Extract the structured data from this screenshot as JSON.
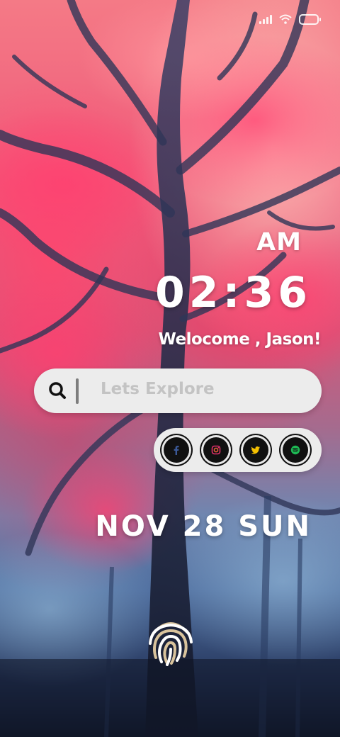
{
  "status_bar": {
    "signal_icon": "signal-bars-icon",
    "wifi_icon": "wifi-icon",
    "battery_icon": "battery-icon"
  },
  "clock": {
    "period": "AM",
    "time": "02:36"
  },
  "greeting": "Welocome , Jason!",
  "search": {
    "icon": "search-icon",
    "placeholder": "Lets Explore"
  },
  "social": [
    {
      "name": "facebook",
      "icon": "facebook-icon",
      "color": "#3b5998"
    },
    {
      "name": "instagram",
      "icon": "instagram-icon",
      "color": "#e1306c"
    },
    {
      "name": "twitter",
      "icon": "twitter-icon",
      "color": "#f5c000"
    },
    {
      "name": "spotify",
      "icon": "spotify-icon",
      "color": "#1db954"
    }
  ],
  "date": "NOV 28 SUN",
  "fingerprint": {
    "icon": "fingerprint-icon",
    "colors": [
      "#d9c39c",
      "#ffffff"
    ]
  }
}
